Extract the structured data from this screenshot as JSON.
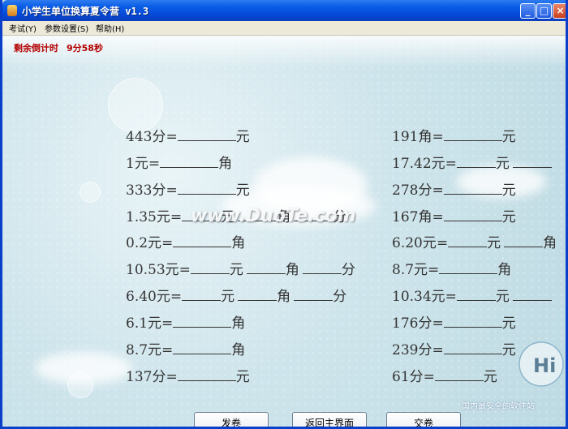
{
  "window": {
    "title": "小学生单位换算夏令营 v1.3",
    "buttons": {
      "minimize": "_",
      "maximize": "□",
      "close": "×"
    }
  },
  "menu": [
    {
      "label": "考试(Y)"
    },
    {
      "label": "参数设置(S)"
    },
    {
      "label": "帮助(H)"
    }
  ],
  "timer": {
    "label": "剩余倒计时",
    "value": "9分58秒"
  },
  "left_questions": [
    {
      "parts": [
        "443分=",
        "元"
      ]
    },
    {
      "parts": [
        "1元=",
        "角"
      ]
    },
    {
      "parts": [
        "333分=",
        "元"
      ]
    },
    {
      "parts": [
        "1.35元=",
        "元",
        "角",
        "分"
      ]
    },
    {
      "parts": [
        "0.2元=",
        "角"
      ]
    },
    {
      "parts": [
        "10.53元=",
        "元",
        "角",
        "分"
      ]
    },
    {
      "parts": [
        "6.40元=",
        "元",
        "角",
        "分"
      ]
    },
    {
      "parts": [
        "6.1元=",
        "角"
      ]
    },
    {
      "parts": [
        "8.7元=",
        "角"
      ]
    },
    {
      "parts": [
        "137分=",
        "元"
      ]
    }
  ],
  "right_questions": [
    {
      "parts": [
        "191角=",
        "元"
      ]
    },
    {
      "parts": [
        "17.42元=",
        "元",
        ""
      ]
    },
    {
      "parts": [
        "278分=",
        "元"
      ]
    },
    {
      "parts": [
        "167角=",
        "元"
      ]
    },
    {
      "parts": [
        "6.20元=",
        "元",
        "角"
      ]
    },
    {
      "parts": [
        "8.7元=",
        "角"
      ]
    },
    {
      "parts": [
        "10.34元=",
        "元",
        ""
      ]
    },
    {
      "parts": [
        "176分=",
        "元"
      ]
    },
    {
      "parts": [
        "239分=",
        "元"
      ]
    },
    {
      "parts": [
        "61分=",
        "元"
      ]
    }
  ],
  "buttons": {
    "exam": "发卷",
    "home": "返回主界面",
    "submit": "交卷"
  },
  "watermark": "www.DuoTe.com",
  "corner_brand": {
    "logo_text": "Hi",
    "site_text": "国内最安全的软件站"
  },
  "colors": {
    "title_bar": "#0a5ee6",
    "timer": "#b40000",
    "background": "#cfe5ec"
  }
}
